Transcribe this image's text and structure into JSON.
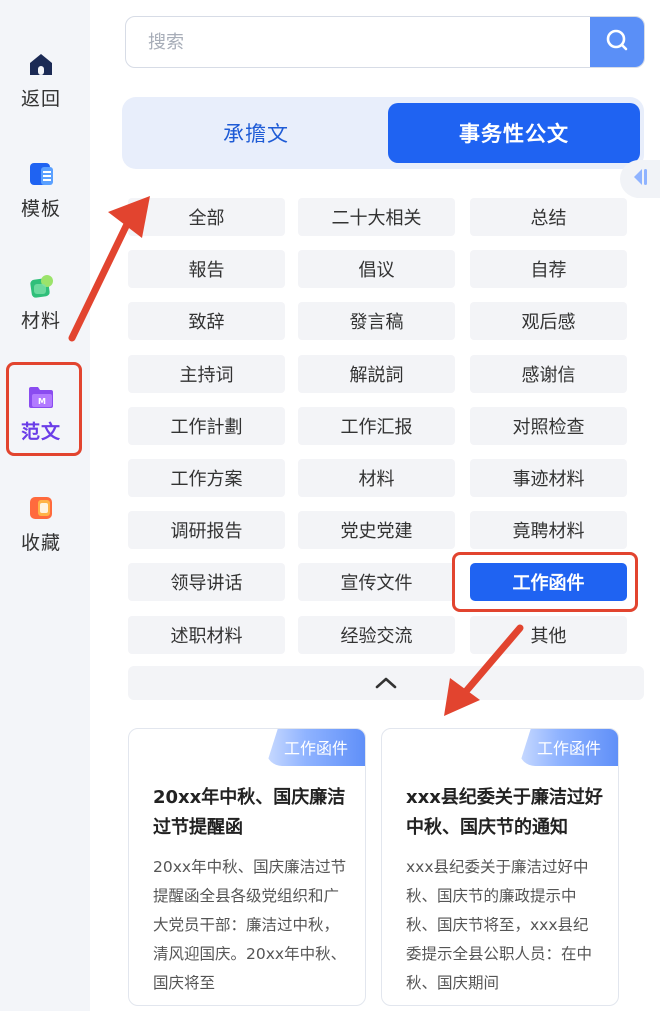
{
  "sidebar": {
    "items": [
      {
        "label": "返回",
        "icon": "home-icon"
      },
      {
        "label": "模板",
        "icon": "template-icon"
      },
      {
        "label": "材料",
        "icon": "material-icon"
      },
      {
        "label": "范文",
        "icon": "sample-essay-icon",
        "active": true
      },
      {
        "label": "收藏",
        "icon": "favorites-icon"
      }
    ]
  },
  "search": {
    "placeholder": "搜索",
    "value": ""
  },
  "tabs": [
    {
      "label": "承擔文",
      "active": false
    },
    {
      "label": "事务性公文",
      "active": true
    }
  ],
  "categories": [
    "全部",
    "二十大相关",
    "总结",
    "報告",
    "倡议",
    "自荐",
    "致辞",
    "發言稿",
    "观后感",
    "主持词",
    "解説詞",
    "感谢信",
    "工作計劃",
    "工作汇报",
    "对照检查",
    "工作方案",
    "材料",
    "事迹材料",
    "调研报告",
    "党史党建",
    "竟聘材料",
    "领导讲话",
    "宣传文件",
    "工作函件",
    "述职材料",
    "经验交流",
    "其他"
  ],
  "active_category": "工作函件",
  "cards": [
    {
      "badge": "工作函件",
      "title": "20xx年中秋、国庆廉洁过节提醒函",
      "desc": "20xx年中秋、国庆廉洁过节提醒函全县各级党组织和广大党员干部：廉洁过中秋，清风迎国庆。20xx年中秋、国庆将至"
    },
    {
      "badge": "工作函件",
      "title": "xxx县纪委关于廉洁过好中秋、国庆节的通知",
      "desc": "xxx县纪委关于廉洁过好中秋、国庆节的廉政提示中秋、国庆节将至，xxx县纪委提示全县公职人员：在中秋、国庆期间"
    }
  ],
  "colors": {
    "accent": "#1f63f2",
    "annotation": "#e2442f",
    "active_nav": "#6a3de8"
  }
}
